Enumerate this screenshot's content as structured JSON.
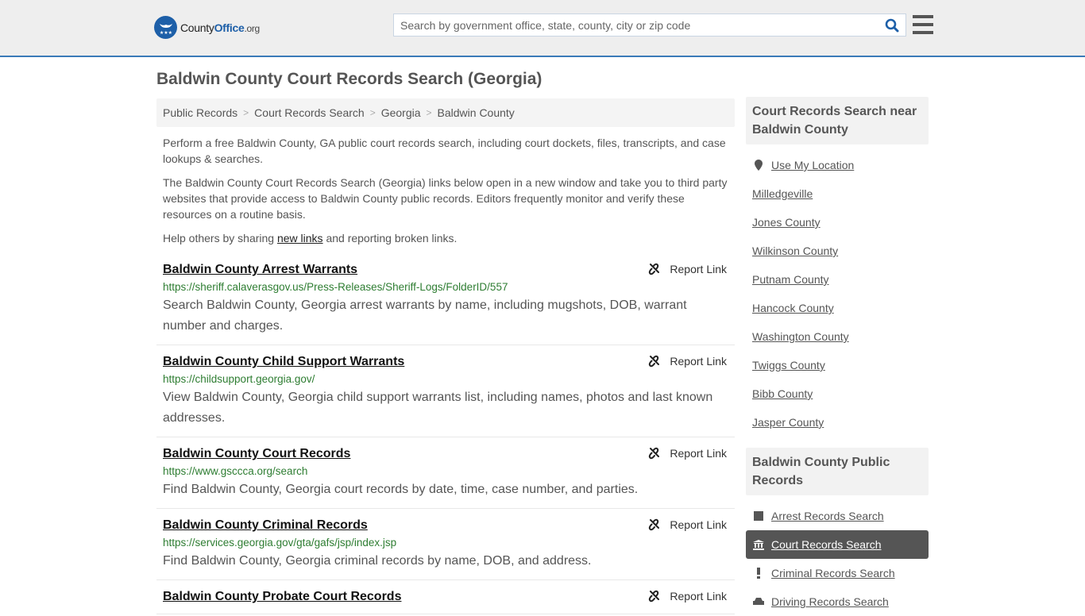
{
  "header": {
    "logo": {
      "brand_part1": "County",
      "brand_part2": "Office",
      "brand_part3": ".org"
    },
    "search_placeholder": "Search by government office, state, county, city or zip code",
    "search_value": ""
  },
  "page_title": "Baldwin County Court Records Search (Georgia)",
  "breadcrumb": [
    "Public Records",
    "Court Records Search",
    "Georgia",
    "Baldwin County"
  ],
  "intro": {
    "p1": "Perform a free Baldwin County, GA public court records search, including court dockets, files, transcripts, and case lookups & searches.",
    "p2": "The Baldwin County Court Records Search (Georgia) links below open in a new window and take you to third party websites that provide access to Baldwin County public records. Editors frequently monitor and verify these resources on a routine basis.",
    "p3_before": "Help others by sharing ",
    "p3_link": "new links",
    "p3_after": " and reporting broken links."
  },
  "report_label": "Report Link",
  "records": [
    {
      "title": "Baldwin County Arrest Warrants",
      "url": "https://sheriff.calaverasgov.us/Press-Releases/Sheriff-Logs/FolderID/557",
      "desc": "Search Baldwin County, Georgia arrest warrants by name, including mugshots, DOB, warrant number and charges."
    },
    {
      "title": "Baldwin County Child Support Warrants",
      "url": "https://childsupport.georgia.gov/",
      "desc": "View Baldwin County, Georgia child support warrants list, including names, photos and last known addresses."
    },
    {
      "title": "Baldwin County Court Records",
      "url": "https://www.gsccca.org/search",
      "desc": "Find Baldwin County, Georgia court records by date, time, case number, and parties."
    },
    {
      "title": "Baldwin County Criminal Records",
      "url": "https://services.georgia.gov/gta/gafs/jsp/index.jsp",
      "desc": "Find Baldwin County, Georgia criminal records by name, DOB, and address."
    },
    {
      "title": "Baldwin County Probate Court Records",
      "url": "",
      "desc": ""
    }
  ],
  "sidebar_nearby": {
    "heading": "Court Records Search near Baldwin County",
    "use_location": "Use My Location",
    "items": [
      "Milledgeville",
      "Jones County",
      "Wilkinson County",
      "Putnam County",
      "Hancock County",
      "Washington County",
      "Twiggs County",
      "Bibb County",
      "Jasper County"
    ]
  },
  "sidebar_public": {
    "heading": "Baldwin County Public Records",
    "items": [
      {
        "label": "Arrest Records Search",
        "icon": "square-icon",
        "active": false
      },
      {
        "label": "Court Records Search",
        "icon": "courthouse-icon",
        "active": true
      },
      {
        "label": "Criminal Records Search",
        "icon": "exclamation-icon",
        "active": false
      },
      {
        "label": "Driving Records Search",
        "icon": "car-icon",
        "active": false
      }
    ]
  },
  "colors": {
    "accent": "#3a7ab8",
    "brand": "#1d5fa8",
    "url_green": "#2e7d32",
    "active_bg": "#555555"
  }
}
